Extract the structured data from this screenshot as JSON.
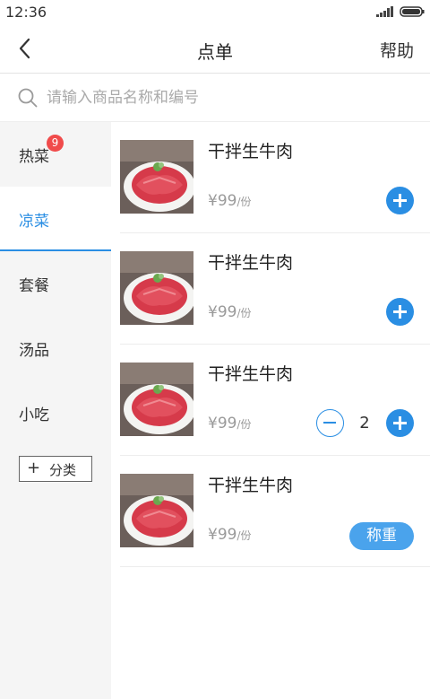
{
  "status_bar": {
    "time": "12:36"
  },
  "nav": {
    "title": "点单",
    "help_label": "帮助"
  },
  "search": {
    "placeholder": "请输入商品名称和编号"
  },
  "sidebar": {
    "categories": [
      {
        "label": "热菜",
        "badge": "9"
      },
      {
        "label": "凉菜",
        "active": true
      },
      {
        "label": "套餐"
      },
      {
        "label": "汤品"
      },
      {
        "label": "小吃"
      }
    ],
    "add_category_label": "分类",
    "add_category_icon": "plus-icon"
  },
  "products": [
    {
      "name": "干拌生牛肉",
      "price": "¥99",
      "unit": "/份",
      "action": "add"
    },
    {
      "name": "干拌生牛肉",
      "price": "¥99",
      "unit": "/份",
      "action": "add"
    },
    {
      "name": "干拌生牛肉",
      "price": "¥99",
      "unit": "/份",
      "action": "stepper",
      "quantity": "2"
    },
    {
      "name": "干拌生牛肉",
      "price": "¥99",
      "unit": "/份",
      "action": "weigh",
      "weigh_label": "称重"
    }
  ],
  "colors": {
    "accent": "#2a8ee3",
    "badge": "#f04b4b",
    "sidebar_bg": "#f5f5f5"
  }
}
